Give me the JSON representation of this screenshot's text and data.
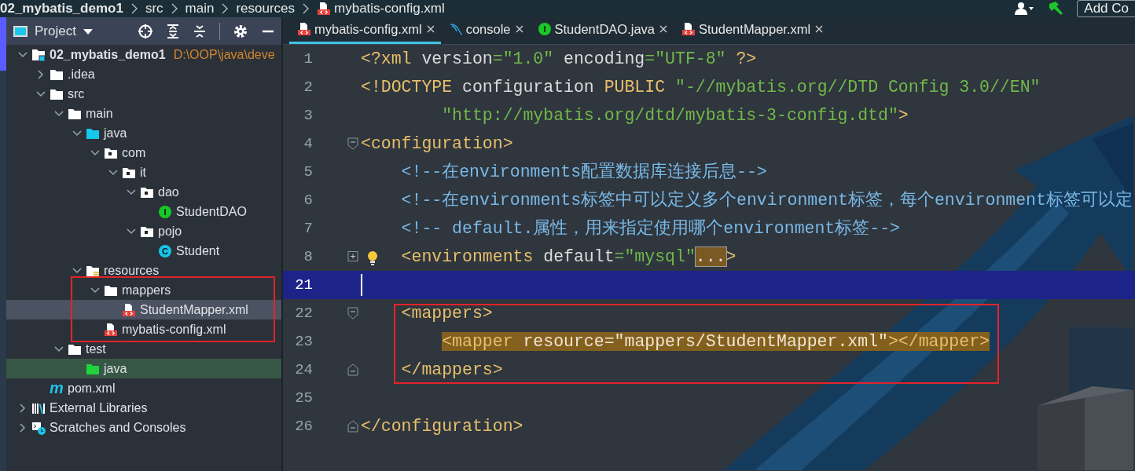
{
  "breadcrumbs": [
    {
      "label": "02_mybatis_demo1",
      "kind": "project"
    },
    {
      "label": "src",
      "kind": "folder"
    },
    {
      "label": "main",
      "kind": "folder"
    },
    {
      "label": "resources",
      "kind": "folder"
    },
    {
      "label": "mybatis-config.xml",
      "kind": "xml"
    }
  ],
  "toolbar": {
    "button": "Add Co"
  },
  "project_panel": {
    "title": "Project",
    "tree": [
      {
        "label": "02_mybatis_demo1",
        "kind": "module",
        "path": "D:\\OOP\\java\\deve",
        "expanded": true,
        "selected": false,
        "children": [
          {
            "label": ".idea",
            "kind": "folder",
            "expanded": false,
            "selected": false
          },
          {
            "label": "src",
            "kind": "folder",
            "expanded": true,
            "selected": false,
            "children": [
              {
                "label": "main",
                "kind": "folder",
                "expanded": true,
                "selected": false,
                "children": [
                  {
                    "label": "java",
                    "kind": "source-folder",
                    "expanded": true,
                    "selected": false,
                    "children": [
                      {
                        "label": "com",
                        "kind": "package",
                        "expanded": true,
                        "selected": false,
                        "children": [
                          {
                            "label": "it",
                            "kind": "package",
                            "expanded": true,
                            "selected": false,
                            "children": [
                              {
                                "label": "dao",
                                "kind": "package",
                                "expanded": true,
                                "selected": false,
                                "children": [
                                  {
                                    "label": "StudentDAO",
                                    "kind": "interface",
                                    "glyph": "I",
                                    "selected": false
                                  }
                                ]
                              },
                              {
                                "label": "pojo",
                                "kind": "package",
                                "expanded": true,
                                "selected": false,
                                "children": [
                                  {
                                    "label": "Student",
                                    "kind": "class",
                                    "glyph": "C",
                                    "selected": false
                                  }
                                ]
                              }
                            ]
                          }
                        ]
                      }
                    ]
                  },
                  {
                    "label": "resources",
                    "kind": "resources-folder",
                    "expanded": true,
                    "selected": false,
                    "children": [
                      {
                        "label": "mappers",
                        "kind": "folder",
                        "expanded": true,
                        "selected": false,
                        "framed": true,
                        "children": [
                          {
                            "label": "StudentMapper.xml",
                            "kind": "xml",
                            "selected": true,
                            "framed": true
                          }
                        ]
                      },
                      {
                        "label": "mybatis-config.xml",
                        "kind": "xml",
                        "selected": false,
                        "framed": true
                      }
                    ]
                  }
                ]
              },
              {
                "label": "test",
                "kind": "folder",
                "expanded": true,
                "selected": false,
                "children": [
                  {
                    "label": "java",
                    "kind": "test-source-folder",
                    "selected": false
                  }
                ]
              }
            ]
          },
          {
            "label": "pom.xml",
            "kind": "maven",
            "glyph": "m",
            "selected": false
          }
        ]
      },
      {
        "label": "External Libraries",
        "kind": "libraries",
        "expanded": false,
        "selected": false
      },
      {
        "label": "Scratches and Consoles",
        "kind": "scratches",
        "expanded": false,
        "selected": false
      }
    ]
  },
  "tabs": [
    {
      "label": "mybatis-config.xml",
      "kind": "xml",
      "selected": true
    },
    {
      "label": "console",
      "kind": "console",
      "selected": false
    },
    {
      "label": "StudentDAO.java",
      "kind": "interface",
      "glyph": "I",
      "selected": false
    },
    {
      "label": "StudentMapper.xml",
      "kind": "xml",
      "selected": false
    }
  ],
  "editor": {
    "lines": [
      {
        "number": "1",
        "kind": "plain",
        "current": false,
        "tokens": [
          {
            "kind": "tag",
            "s": "<?xml"
          },
          {
            "kind": "attr",
            "s": " version"
          },
          {
            "kind": "str",
            "s": "=\"1.0\""
          },
          {
            "kind": "attr",
            "s": " encoding"
          },
          {
            "kind": "str",
            "s": "=\"UTF-8\""
          },
          {
            "kind": "tag",
            "s": " ?>"
          }
        ]
      },
      {
        "number": "2",
        "kind": "plain",
        "current": false,
        "tokens": [
          {
            "kind": "tag",
            "s": "<!DOCTYPE"
          },
          {
            "kind": "attr",
            "s": " configuration"
          },
          {
            "kind": "tag",
            "s": " PUBLIC"
          },
          {
            "kind": "str",
            "s": " \"-//mybatis.org//DTD Config 3.0//EN\""
          }
        ]
      },
      {
        "number": "3",
        "kind": "plain",
        "current": false,
        "tokens": [
          {
            "kind": "str",
            "s": "        \"http://mybatis.org/dtd/mybatis-3-config.dtd\""
          },
          {
            "kind": "tag",
            "s": ">"
          }
        ]
      },
      {
        "number": "4",
        "kind": "fold-start",
        "current": false,
        "tokens": [
          {
            "kind": "tag",
            "s": "<configuration>"
          }
        ]
      },
      {
        "number": "5",
        "kind": "plain",
        "current": false,
        "tokens": [
          {
            "kind": "com",
            "s": "    <!--在environments配置数据库连接后息-->"
          }
        ]
      },
      {
        "number": "6",
        "kind": "plain",
        "current": false,
        "tokens": [
          {
            "kind": "com",
            "s": "    <!--在environments标签中可以定义多个environment标签，每个environment标签可以定"
          }
        ]
      },
      {
        "number": "7",
        "kind": "plain",
        "current": false,
        "tokens": [
          {
            "kind": "com",
            "s": "    <!-- default.属性，用来指定使用哪个environment标签-->"
          }
        ]
      },
      {
        "number": "8",
        "kind": "folded",
        "current": false,
        "hint": true,
        "tokens": [
          {
            "kind": "tag",
            "s": "    <environments"
          },
          {
            "kind": "attr",
            "s": " default"
          },
          {
            "kind": "str",
            "s": "=\"mysql\""
          },
          {
            "kind": "fold",
            "s": "..."
          },
          {
            "kind": "tag",
            "s": ">"
          }
        ]
      },
      {
        "number": "21",
        "kind": "plain",
        "current": true
      },
      {
        "number": "22",
        "kind": "fold-start",
        "current": false,
        "framed": true,
        "tokens": [
          {
            "kind": "tag",
            "s": "    <mappers>"
          }
        ]
      },
      {
        "number": "23",
        "kind": "plain",
        "current": false,
        "marked": true,
        "framed": true,
        "tokens": [
          {
            "kind": "tag",
            "s": "        <mapper"
          },
          {
            "kind": "attr",
            "s": " resource"
          },
          {
            "kind": "str",
            "s": "=\"mappers/StudentMapper.xml\""
          },
          {
            "kind": "tag",
            "s": "></mapper>"
          }
        ]
      },
      {
        "number": "24",
        "kind": "fold-end",
        "current": false,
        "framed": true,
        "tokens": [
          {
            "kind": "tag",
            "s": "    </mappers>"
          }
        ]
      },
      {
        "number": "25",
        "kind": "plain",
        "current": false
      },
      {
        "number": "26",
        "kind": "fold-end",
        "current": false,
        "tokens": [
          {
            "kind": "tag",
            "s": "</configuration>"
          }
        ]
      }
    ]
  }
}
